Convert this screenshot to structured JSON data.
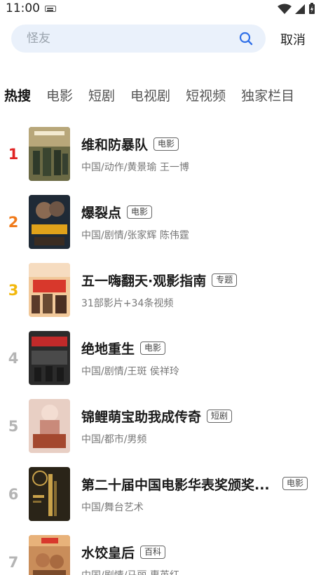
{
  "status_bar": {
    "time": "11:00"
  },
  "search": {
    "placeholder": "怪友",
    "cancel_label": "取消"
  },
  "tabs": [
    "热搜",
    "电影",
    "短剧",
    "电视剧",
    "短视频",
    "独家栏目"
  ],
  "colors": {
    "rank_1": "#e02424",
    "rank_2": "#f07a1a",
    "rank_3": "#f2b80d",
    "rank_other": "#b5b5b5",
    "search_bg": "#eaf1fb",
    "accent": "#2f6fe8"
  },
  "items": [
    {
      "rank": "1",
      "title": "维和防暴队",
      "badge": "电影",
      "subtitle": "中国/动作/黄景瑜 王一博",
      "poster_icon": "movie-poster"
    },
    {
      "rank": "2",
      "title": "爆裂点",
      "badge": "电影",
      "subtitle": "中国/剧情/张家辉 陈伟霆",
      "poster_icon": "movie-poster"
    },
    {
      "rank": "3",
      "title": "五一嗨翻天·观影指南",
      "badge": "专题",
      "subtitle": "31部影片+34条视频",
      "poster_icon": "topic-poster"
    },
    {
      "rank": "4",
      "title": "绝地重生",
      "badge": "电影",
      "subtitle": "中国/剧情/王斑 侯祥玲",
      "poster_icon": "movie-poster"
    },
    {
      "rank": "5",
      "title": "锦鲤萌宝助我成传奇",
      "badge": "短剧",
      "subtitle": "中国/都市/男频",
      "poster_icon": "drama-poster"
    },
    {
      "rank": "6",
      "title": "第二十届中国电影华表奖颁奖...",
      "badge": "电影",
      "subtitle": "中国/舞台艺术",
      "poster_icon": "ceremony-poster"
    },
    {
      "rank": "7",
      "title": "水饺皇后",
      "badge": "百科",
      "subtitle": "中国/剧情/马丽 惠英红",
      "poster_icon": "movie-poster"
    }
  ]
}
